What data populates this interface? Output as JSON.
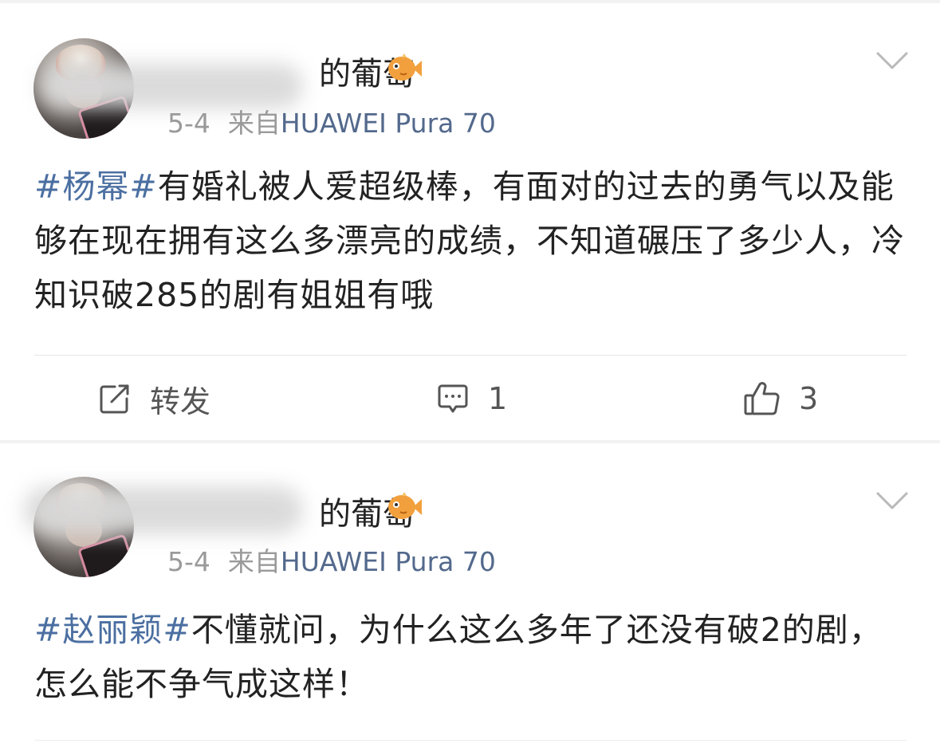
{
  "posts": [
    {
      "username_visible": "的葡萄",
      "date": "5-4",
      "source_prefix": "来自",
      "device": "HUAWEI Pura 70",
      "hashtag": "#杨幂#",
      "text": "有婚礼被人爱超级棒，有面对的过去的勇气以及能够在现在拥有这么多漂亮的成绩，不知道碾压了多少人，冷知识破285的剧有姐姐有哦",
      "actions": {
        "repost_label": "转发",
        "comment_count": "1",
        "like_count": "3"
      }
    },
    {
      "username_visible": "的葡萄",
      "date": "5-4",
      "source_prefix": "来自",
      "device": "HUAWEI Pura 70",
      "hashtag": "#赵丽颖#",
      "text": "不懂就问，为什么这么多年了还没有破2的剧，怎么能不争气成这样！"
    }
  ],
  "icons": {
    "vip": "fish-vip-icon",
    "more": "chevron-down-icon",
    "repost": "share-edit-icon",
    "comment": "comment-icon",
    "like": "thumbs-up-icon"
  },
  "colors": {
    "hashtag": "#4b6fa1",
    "device": "#53698c",
    "meta": "#9a9a9a",
    "text": "#222222",
    "vip_orange": "#f2a03d"
  }
}
